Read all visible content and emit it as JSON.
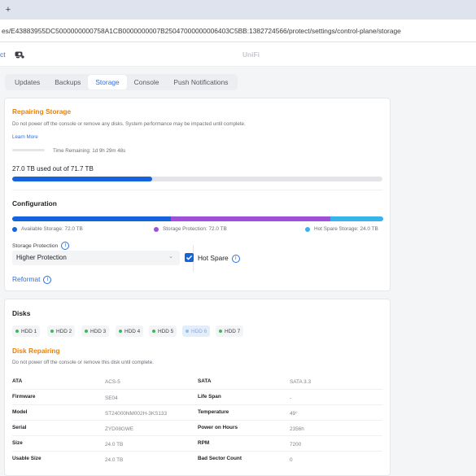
{
  "browser": {
    "new_tab_glyph": "+",
    "url": "es/E43883955DC5000000000758A1CB0000000007B25047000000006403C5BB:1382724566/protect/settings/control-plane/storage"
  },
  "header": {
    "crumb": "ct",
    "logo_text": "UniFi"
  },
  "tabs": [
    {
      "label": "Updates"
    },
    {
      "label": "Backups"
    },
    {
      "label": "Storage"
    },
    {
      "label": "Console"
    },
    {
      "label": "Push Notifications"
    }
  ],
  "repair": {
    "title": "Repairing Storage",
    "warning": "Do not power off the console or remove any disks. System performance may be impacted until complete.",
    "learn_more": "Learn More",
    "time_remaining": "Time Remaining: 1d 9h 29m 48s",
    "progress": 0,
    "usage_text": "27.0 TB used out of 71.7 TB",
    "usage_fraction": 0.377
  },
  "config": {
    "title": "Configuration",
    "segments": [
      {
        "label": "Available Storage: 72.0 TB",
        "color": "#1364dd",
        "value": 72
      },
      {
        "label": "Storage Protection: 72.0 TB",
        "color": "#a04fdb",
        "value": 72
      },
      {
        "label": "Hot Spare Storage: 24.0 TB",
        "color": "#38b3ec",
        "value": 24
      }
    ],
    "protection_label": "Storage Protection",
    "protection_value": "Higher Protection",
    "hot_spare_label": "Hot Spare",
    "reformat_label": "Reformat"
  },
  "disks": {
    "title": "Disks",
    "items": [
      "HDD 1",
      "HDD 2",
      "HDD 3",
      "HDD 4",
      "HDD 5",
      "HDD 6",
      "HDD 7"
    ],
    "repairing_title": "Disk Repairing",
    "repairing_warning": "Do not power off the console or remove this disk until complete.",
    "details_left": [
      {
        "label": "ATA",
        "value": "ACS-5"
      },
      {
        "label": "Firmware",
        "value": "SE04"
      },
      {
        "label": "Model",
        "value": "ST24000NM002H-3KS133"
      },
      {
        "label": "Serial",
        "value": "ZYD08GWE"
      },
      {
        "label": "Size",
        "value": "24.0 TB"
      },
      {
        "label": "Usable Size",
        "value": "24.0 TB"
      }
    ],
    "details_right": [
      {
        "label": "SATA",
        "value": "SATA 3.3"
      },
      {
        "label": "Life Span",
        "value": "-"
      },
      {
        "label": "Temperature",
        "value": "49°"
      },
      {
        "label": "Power on Hours",
        "value": "2356h"
      },
      {
        "label": "RPM",
        "value": "7200"
      },
      {
        "label": "Bad Sector Count",
        "value": "0"
      }
    ]
  }
}
